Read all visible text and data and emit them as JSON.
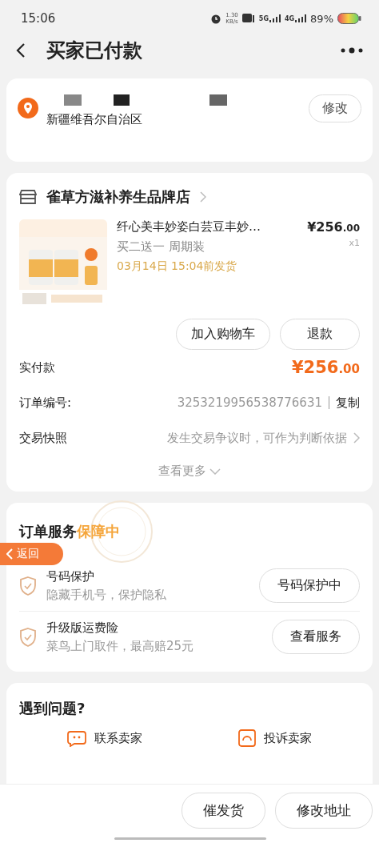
{
  "status_bar": {
    "time": "15:06",
    "net_speed": "1.30",
    "net_unit": "KB/s",
    "signals": [
      "5G",
      "4G"
    ],
    "battery": "89%"
  },
  "header": {
    "title": "买家已付款"
  },
  "address": {
    "region": "新疆维吾尔自治区",
    "edit_button": "修改"
  },
  "store": {
    "name": "雀草方滋补养生品牌店",
    "item": {
      "title": "纤心美丰妙姿白芸豆丰妙…",
      "spec": "买二送一 周期装",
      "ship_time": "03月14日 15:04前发货",
      "price": {
        "main": "¥256",
        "cents": ".00"
      },
      "quantity": "x1"
    },
    "actions": [
      "加入购物车",
      "退款"
    ],
    "paid": {
      "label": "实付款",
      "price": {
        "main": "¥256",
        "cents": ".00"
      }
    },
    "order_no": {
      "label": "订单编号:",
      "value": "3253219956538776631",
      "action": "复制"
    },
    "snapshot": {
      "label": "交易快照",
      "value": "发生交易争议时，可作为判断依据"
    },
    "more": "查看更多"
  },
  "service": {
    "title": "订单服务",
    "badge": "保障中",
    "items": [
      {
        "title": "号码保护",
        "desc": "隐藏手机号，保护隐私",
        "button": "号码保护中"
      },
      {
        "title": "升级版运费险",
        "desc": "菜鸟上门取件，最高赔25元",
        "button": "查看服务"
      }
    ]
  },
  "float_back": "返回",
  "problems": {
    "title": "遇到问题?",
    "entries": [
      {
        "kind": "chat",
        "label": "联系卖家"
      },
      {
        "kind": "complaint",
        "label": "投诉卖家"
      }
    ]
  },
  "bottom_buttons": [
    "催发货",
    "修改地址"
  ]
}
